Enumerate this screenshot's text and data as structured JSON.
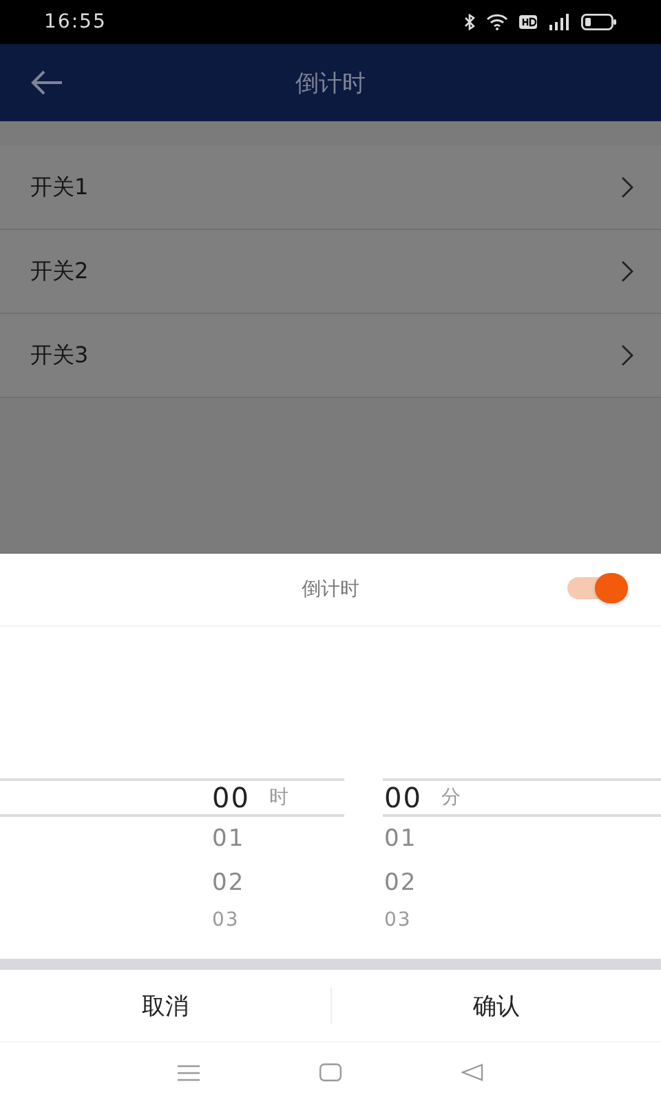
{
  "status_bar": {
    "time": "16:55"
  },
  "header": {
    "title": "倒计时"
  },
  "switches": [
    {
      "label": "开关1"
    },
    {
      "label": "开关2"
    },
    {
      "label": "开关3"
    }
  ],
  "sheet": {
    "title": "倒计时",
    "toggle": {
      "on": true
    },
    "pickers": [
      {
        "unit": "时",
        "items": [
          {
            "value": "00",
            "selected": true
          },
          {
            "value": "01",
            "selected": false
          },
          {
            "value": "02",
            "selected": false
          },
          {
            "value": "03",
            "selected": false
          }
        ]
      },
      {
        "unit": "分",
        "items": [
          {
            "value": "00",
            "selected": true
          },
          {
            "value": "01",
            "selected": false
          },
          {
            "value": "02",
            "selected": false
          },
          {
            "value": "03",
            "selected": false
          }
        ]
      }
    ],
    "buttons": [
      "取消",
      "确认"
    ]
  }
}
